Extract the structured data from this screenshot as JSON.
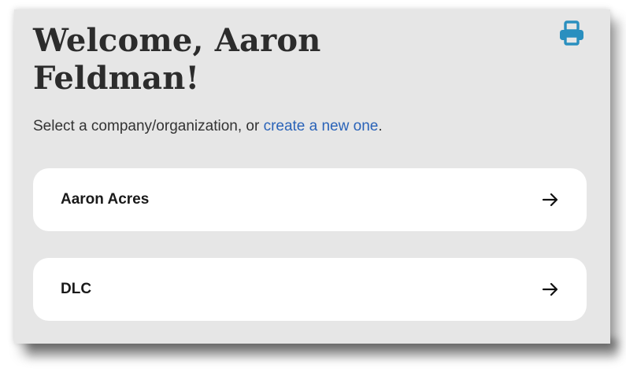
{
  "header": {
    "title": "Welcome, Aaron Feldman!",
    "print_icon": "print-icon"
  },
  "intro": {
    "prefix": "Select a company/organization, or ",
    "link_text": "create a new one",
    "suffix": "."
  },
  "organizations": [
    {
      "name": "Aaron Acres",
      "icon": "arrow-right-icon"
    },
    {
      "name": "DLC",
      "icon": "arrow-right-icon"
    }
  ],
  "colors": {
    "panel_bg": "#e6e6e6",
    "card_bg": "#ffffff",
    "link": "#2a63b8",
    "print_icon": "#2a8fbf",
    "title_text": "#2c2c2c"
  }
}
